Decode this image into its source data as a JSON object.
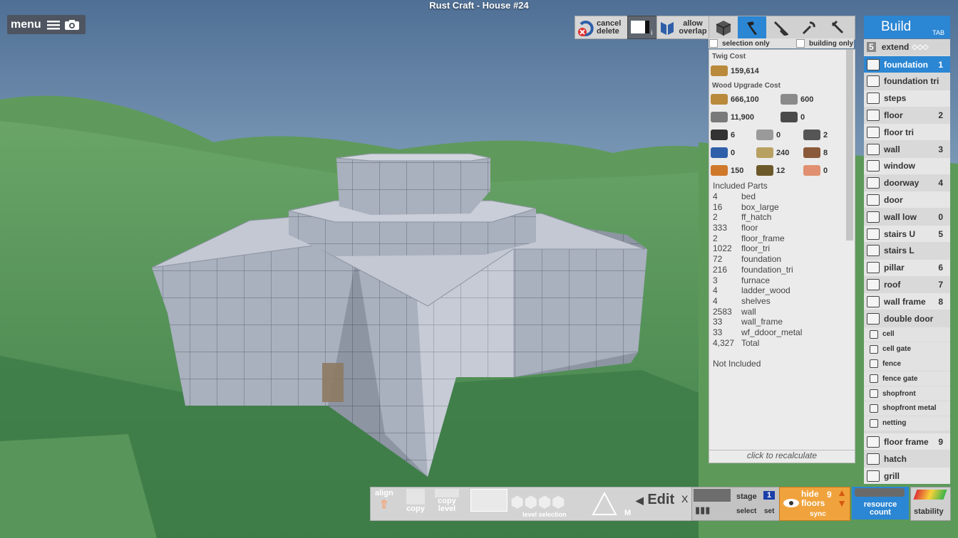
{
  "window_title": "Rust Craft - House #24",
  "menu": {
    "label": "menu"
  },
  "toolbar": {
    "cancel_delete": [
      "cancel",
      "delete"
    ],
    "allow_overlap": [
      "allow",
      "overlap"
    ],
    "tools": [
      "blocks-icon",
      "hammer-icon",
      "shovel-icon",
      "wrench-icon",
      "pickaxe-icon"
    ],
    "selection_only": "selection only",
    "building_only": "building only"
  },
  "cost": {
    "twig_title": "Twig Cost",
    "twig_value": "159,614",
    "wood_title": "Wood Upgrade Cost",
    "resources": [
      {
        "value": "666,100",
        "color": "#b9893c"
      },
      {
        "value": "600",
        "color": "#8a8a8a"
      },
      {
        "value": "11,900",
        "color": "#7a7a7a"
      },
      {
        "value": "0",
        "color": "#4a4a4a"
      },
      {
        "value": "6",
        "color": "#333333"
      },
      {
        "value": "0",
        "color": "#9a9a9a"
      },
      {
        "value": "2",
        "color": "#555555"
      },
      {
        "value": "0",
        "color": "#2f5fa8"
      },
      {
        "value": "240",
        "color": "#b8a060"
      },
      {
        "value": "8",
        "color": "#8a5a3a"
      },
      {
        "value": "150",
        "color": "#d0782a"
      },
      {
        "value": "12",
        "color": "#6d5a2a"
      },
      {
        "value": "0",
        "color": "#e09070"
      }
    ],
    "included_title": "Included Parts",
    "parts": [
      {
        "qty": "4",
        "name": "bed"
      },
      {
        "qty": "16",
        "name": "box_large"
      },
      {
        "qty": "2",
        "name": "ff_hatch"
      },
      {
        "qty": "333",
        "name": "floor"
      },
      {
        "qty": "2",
        "name": "floor_frame"
      },
      {
        "qty": "1022",
        "name": "floor_tri"
      },
      {
        "qty": "72",
        "name": "foundation"
      },
      {
        "qty": "216",
        "name": "foundation_tri"
      },
      {
        "qty": "3",
        "name": "furnace"
      },
      {
        "qty": "4",
        "name": "ladder_wood"
      },
      {
        "qty": "4",
        "name": "shelves"
      },
      {
        "qty": "2583",
        "name": "wall"
      },
      {
        "qty": "33",
        "name": "wall_frame"
      },
      {
        "qty": "33",
        "name": "wf_ddoor_metal"
      },
      {
        "qty": "4,327",
        "name": "Total"
      }
    ],
    "not_included_title": "Not Included",
    "recalc": "click to recalculate"
  },
  "build": {
    "title": "Build",
    "tab_hint": "TAB",
    "extend_count": "5",
    "extend_label": "extend",
    "items": [
      {
        "label": "foundation",
        "key": "1",
        "selected": true
      },
      {
        "label": "foundation tri",
        "key": ""
      },
      {
        "label": "steps",
        "key": ""
      },
      {
        "label": "floor",
        "key": "2"
      },
      {
        "label": "floor tri",
        "key": ""
      },
      {
        "label": "wall",
        "key": "3"
      },
      {
        "label": "window",
        "key": ""
      },
      {
        "label": "doorway",
        "key": "4"
      },
      {
        "label": "door",
        "key": ""
      },
      {
        "label": "wall low",
        "key": "0"
      },
      {
        "label": "stairs U",
        "key": "5"
      },
      {
        "label": "stairs L",
        "key": ""
      },
      {
        "label": "pillar",
        "key": "6"
      },
      {
        "label": "roof",
        "key": "7"
      },
      {
        "label": "wall frame",
        "key": "8"
      },
      {
        "label": "double door",
        "key": ""
      }
    ],
    "sub_items": [
      "cell",
      "cell gate",
      "fence",
      "fence gate",
      "shopfront",
      "shopfront metal",
      "netting"
    ],
    "items2": [
      {
        "label": "floor frame",
        "key": "9"
      },
      {
        "label": "hatch",
        "key": ""
      },
      {
        "label": "grill",
        "key": ""
      }
    ]
  },
  "bottom": {
    "align": "align",
    "copy": "copy",
    "copy_level": [
      "copy",
      "level"
    ],
    "level_selection": "level selection",
    "m_key": "M",
    "edit": "Edit",
    "x": "X",
    "stage": "stage",
    "stage_value": "1",
    "select": "select",
    "set": "set",
    "hide_floors": [
      "hide",
      "floors"
    ],
    "hide_count": "9",
    "sync": "sync",
    "resource_count": [
      "resource",
      "count"
    ],
    "stability": "stability"
  }
}
